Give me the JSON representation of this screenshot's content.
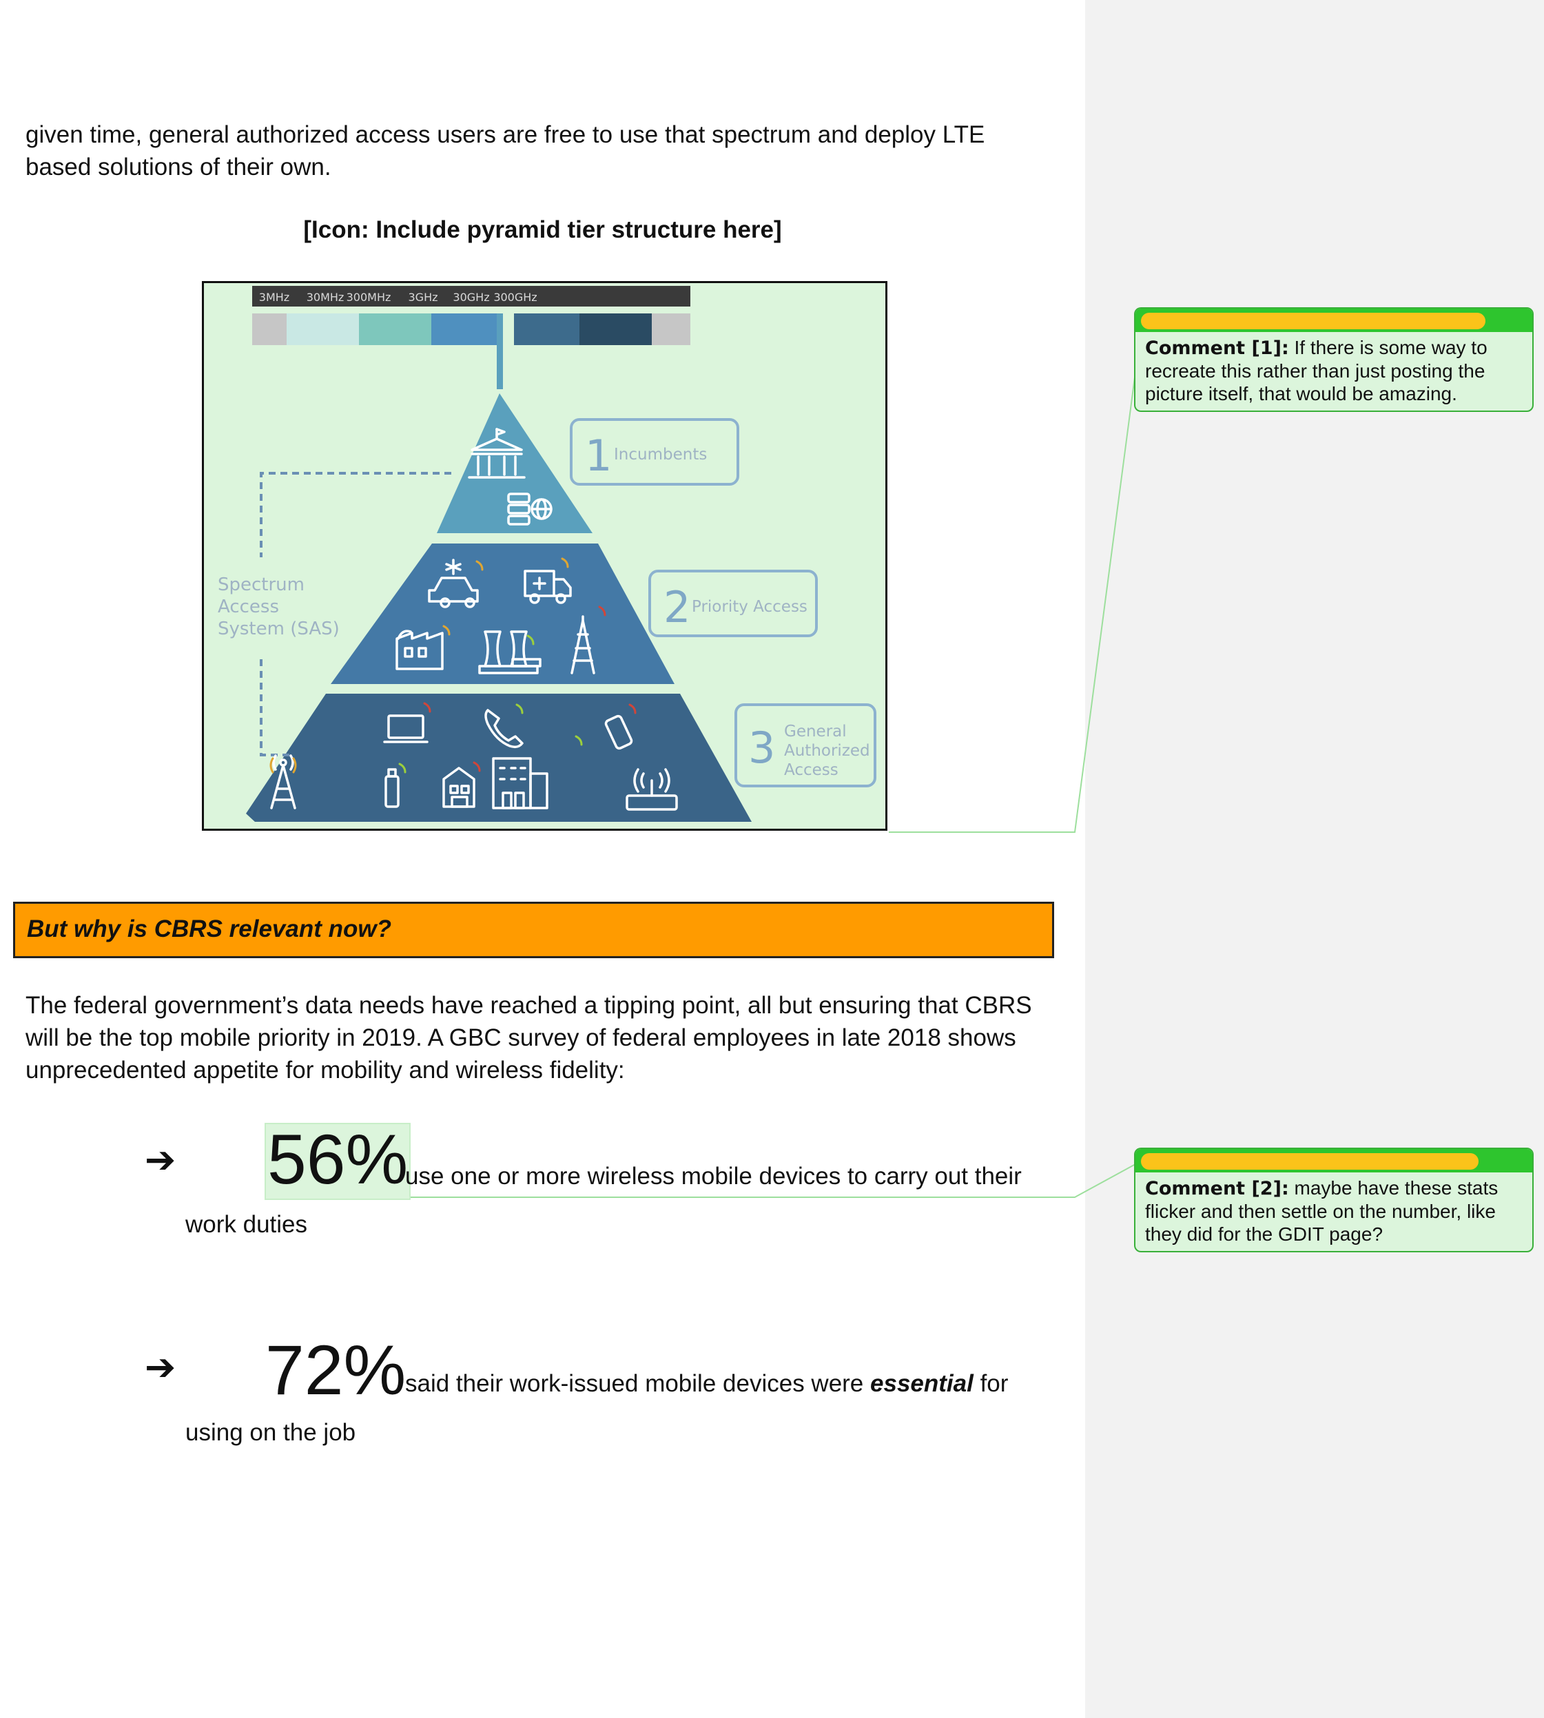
{
  "body": {
    "para1_line1": "given time, general authorized access users are free to use that spectrum and deploy LTE",
    "para1_line2": "based solutions of their own.",
    "icon_placeholder": "[Icon: Include pyramid tier structure here]",
    "section_heading": "But why is CBRS relevant now?",
    "para2_line1": "The federal government’s data needs have reached a tipping point, all but ensuring that CBRS",
    "para2_line2": "will be the top mobile priority in 2019. A GBC survey of federal employees in late 2018 shows",
    "para2_line3": "unprecedented appetite for mobility and wireless fidelity:"
  },
  "figure": {
    "frequency_labels": [
      "3MHz",
      "30MHz",
      "300MHz",
      "3GHz",
      "30GHz",
      "300GHz"
    ],
    "spectrum_colors": [
      "#c6c6c6",
      "#c9e8e4",
      "#7ec7bc",
      "#4f90bf",
      "#3d6b8c",
      "#2a4b63",
      "#c6c6c6"
    ],
    "sas_label_lines": [
      "Spectrum",
      "Access",
      "System (SAS)"
    ],
    "tiers": [
      {
        "number": "1",
        "label_lines": [
          "Incumbents"
        ],
        "color": "#5aa0bd"
      },
      {
        "number": "2",
        "label_lines": [
          "Priority Access"
        ],
        "color": "#4479a6"
      },
      {
        "number": "3",
        "label_lines": [
          "General",
          "Authorized",
          "Access"
        ],
        "color": "#3a6488"
      }
    ],
    "icons": [
      "government-building-icon",
      "server-globe-icon",
      "police-car-icon",
      "ambulance-icon",
      "factory-icon",
      "power-plant-icon",
      "radio-tower-icon",
      "laptop-icon",
      "phone-icon",
      "mobile-phone-icon",
      "cell-tower-icon",
      "usb-modem-icon",
      "house-icon",
      "office-building-icon",
      "wifi-router-icon"
    ]
  },
  "stats": [
    {
      "arrow": "➔",
      "value": "56%",
      "text": "use one or more wireless mobile devices to carry out their",
      "continuation": "work duties"
    },
    {
      "arrow": "➔",
      "value": "72%",
      "text_before": "said their work-issued mobile devices were",
      "emphasis": "essential",
      "text_after": "for",
      "continuation": "using on the job"
    }
  ],
  "comments": [
    {
      "label": "Comment [1]:",
      "lines": [
        "If there is some way to",
        "recreate this rather than just posting the",
        "picture itself, that would be amazing."
      ]
    },
    {
      "label": "Comment [2]:",
      "lines": [
        "maybe have these stats",
        "flicker and then settle on the number, like",
        "they did for the GDIT page?"
      ]
    }
  ]
}
